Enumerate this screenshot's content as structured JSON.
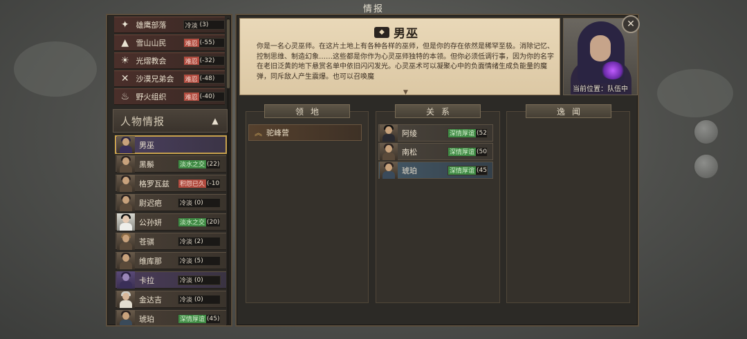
{
  "window_title": "情报",
  "factions": [
    {
      "name": "雄鹰部落",
      "status": "冷淡",
      "value": "(3)",
      "color": "grey",
      "icon": "eagle-icon"
    },
    {
      "name": "雪山山民",
      "status": "难忍",
      "value": "(-55)",
      "color": "red",
      "icon": "mountain-icon"
    },
    {
      "name": "光熠教会",
      "status": "难忍",
      "value": "(-32)",
      "color": "red",
      "icon": "sun-icon"
    },
    {
      "name": "沙漠兄弟会",
      "status": "难忍",
      "value": "(-48)",
      "color": "red",
      "icon": "crossed-swords-icon"
    },
    {
      "name": "野火组织",
      "status": "难忍",
      "value": "(-40)",
      "color": "red",
      "icon": "flame-icon"
    }
  ],
  "character_section": {
    "title": "人物情报",
    "toggle_icon": "chevron-up-icon"
  },
  "characters": [
    {
      "name": "男巫",
      "status": "",
      "value": "",
      "color": "none",
      "selected": true
    },
    {
      "name": "黑鬃",
      "status": "淡水之交",
      "value": "(22)",
      "color": "green"
    },
    {
      "name": "格罗瓦兹",
      "status": "积怨已久",
      "value": "(-10)",
      "color": "red"
    },
    {
      "name": "尉迟疤",
      "status": "冷淡",
      "value": "(0)",
      "color": "grey"
    },
    {
      "name": "公孙妍",
      "status": "淡水之交",
      "value": "(20)",
      "color": "green"
    },
    {
      "name": "苍骐",
      "status": "冷淡",
      "value": "(2)",
      "color": "grey"
    },
    {
      "name": "维库那",
      "status": "冷淡",
      "value": "(5)",
      "color": "grey"
    },
    {
      "name": "卡拉",
      "status": "冷淡",
      "value": "(0)",
      "color": "grey",
      "purple": true
    },
    {
      "name": "金达吉",
      "status": "冷淡",
      "value": "(0)",
      "color": "grey"
    },
    {
      "name": "琥珀",
      "status": "深情厚谊",
      "value": "(45)",
      "color": "green"
    }
  ],
  "detail": {
    "name": "男巫",
    "description": "你是一名心灵巫师。在这片土地上有各种各样的巫师，但是你的存在依然是稀罕至极。消除记忆、控制思维、制造幻象……这些都是你作为心灵巫师独特的本领。但你必须低调行事，因为你的名字在老旧泛黄的地下悬赏名单中依旧闪闪发光。心灵巫术可以凝聚心中的负面情绪生成负能量的魔弹，同斥敌人产生震爆。也可以召唤魔",
    "location_label": "当前位置：队伍中",
    "expand_icon": "chevron-down-icon"
  },
  "tabs": {
    "territory": "领地",
    "relations": "关系",
    "anecdotes": "逸闻"
  },
  "territory_items": [
    {
      "label": "驼峰营"
    }
  ],
  "relations": [
    {
      "name": "阿绫",
      "status": "深情厚谊",
      "value": "(52)"
    },
    {
      "name": "南松",
      "status": "深情厚谊",
      "value": "(50)"
    },
    {
      "name": "琥珀",
      "status": "深情厚谊",
      "value": "(45)"
    }
  ],
  "close_icon": "close-icon"
}
